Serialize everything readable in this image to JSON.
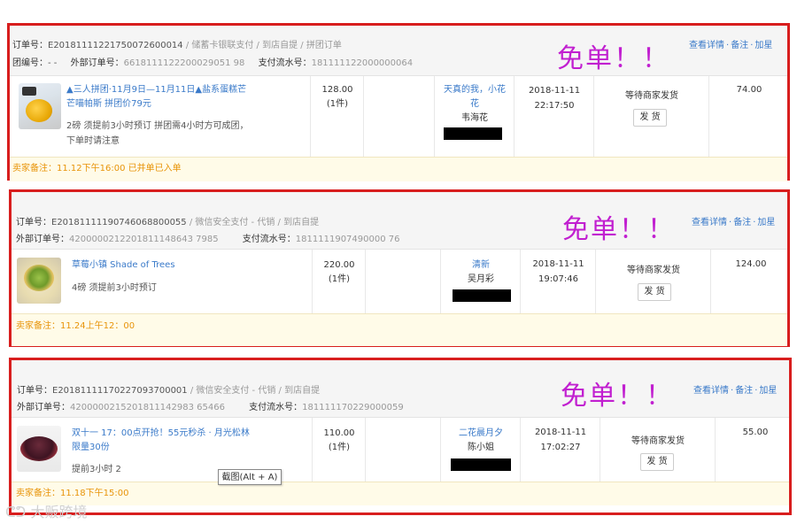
{
  "orders": [
    {
      "header_line1": {
        "order_label": "订单号：",
        "order_no": "E20181111221750072600014",
        "method": " / 储蓄卡银联支付 / 到店自提 / 拼团订单"
      },
      "header_line2": {
        "group_label": "团编号：",
        "group_no": "- -",
        "ext_label": "外部订单号：",
        "ext_no": "6618111122200029051 98",
        "pay_label": "支付流水号：",
        "pay_no": "181111122000000064"
      },
      "links": {
        "detail": "查看详情",
        "note": "备注",
        "star": "加星"
      },
      "free_text": "免单！！",
      "product": {
        "name": "▲三人拼团·11月9日—11月11日▲盐系蛋糕芒芒喵帕斯 拼团价79元",
        "desc": "2磅 须提前3小时预订 拼团需4小时方可成团，下单时请注意",
        "price": "128.00",
        "qty": "(1件)"
      },
      "buyer": {
        "nick": "天真的我，小花花",
        "name": "韦海花"
      },
      "date": "2018-11-11",
      "time": "22:17:50",
      "status": "等待商家发货",
      "ship_btn": "发 货",
      "amount": "74.00",
      "remark": "卖家备注：11.12下午16:00 已并单已入单"
    },
    {
      "header_line1": {
        "order_label": "订单号：",
        "order_no": "E20181111190746068800055",
        "method": " / 微信安全支付 - 代销 / 到店自提"
      },
      "header_line2": {
        "ext_label": "外部订单号：",
        "ext_no": "4200000212201811148643 7985",
        "pay_label": "支付流水号：",
        "pay_no": "1811111907490000 76"
      },
      "links": {
        "detail": "查看详情",
        "note": "备注",
        "star": "加星"
      },
      "free_text": "免单！！",
      "product": {
        "name": "草莓小镇 Shade of Trees",
        "desc": "4磅 须提前3小时预订",
        "price": "220.00",
        "qty": "(1件)"
      },
      "buyer": {
        "nick": "清新",
        "name": "吴月彩"
      },
      "date": "2018-11-11",
      "time": "19:07:46",
      "status": "等待商家发货",
      "ship_btn": "发 货",
      "amount": "124.00",
      "remark": "卖家备注：11.24上午12：00"
    },
    {
      "header_line1": {
        "order_label": "订单号：",
        "order_no": "E20181111170227093700001",
        "method": " / 微信安全支付 - 代销 / 到店自提"
      },
      "header_line2": {
        "ext_label": "外部订单号：",
        "ext_no": "4200000215201811142983 65466",
        "pay_label": "支付流水号：",
        "pay_no": "181111170229000059"
      },
      "links": {
        "detail": "查看详情",
        "note": "备注",
        "star": "加星"
      },
      "free_text": "免单！！",
      "product": {
        "name": "双十一 17：00点开抢！55元秒杀 · 月光松林 限量30份",
        "desc": "提前3小时 2",
        "price": "110.00",
        "qty": "(1件)"
      },
      "buyer": {
        "nick": "二花晨月夕",
        "name": "陈小姐"
      },
      "date": "2018-11-11",
      "time": "17:02:27",
      "status": "等待商家发货",
      "ship_btn": "发 货",
      "amount": "55.00",
      "remark": "卖家备注：11.18下午15:00"
    }
  ],
  "tooltip": "截图(Alt + A)",
  "watermark": "大贩跨境",
  "colors": {
    "border": "#d81e1e",
    "free": "#c11fd0",
    "link": "#3a7ac9",
    "remark": "#e8940a"
  }
}
